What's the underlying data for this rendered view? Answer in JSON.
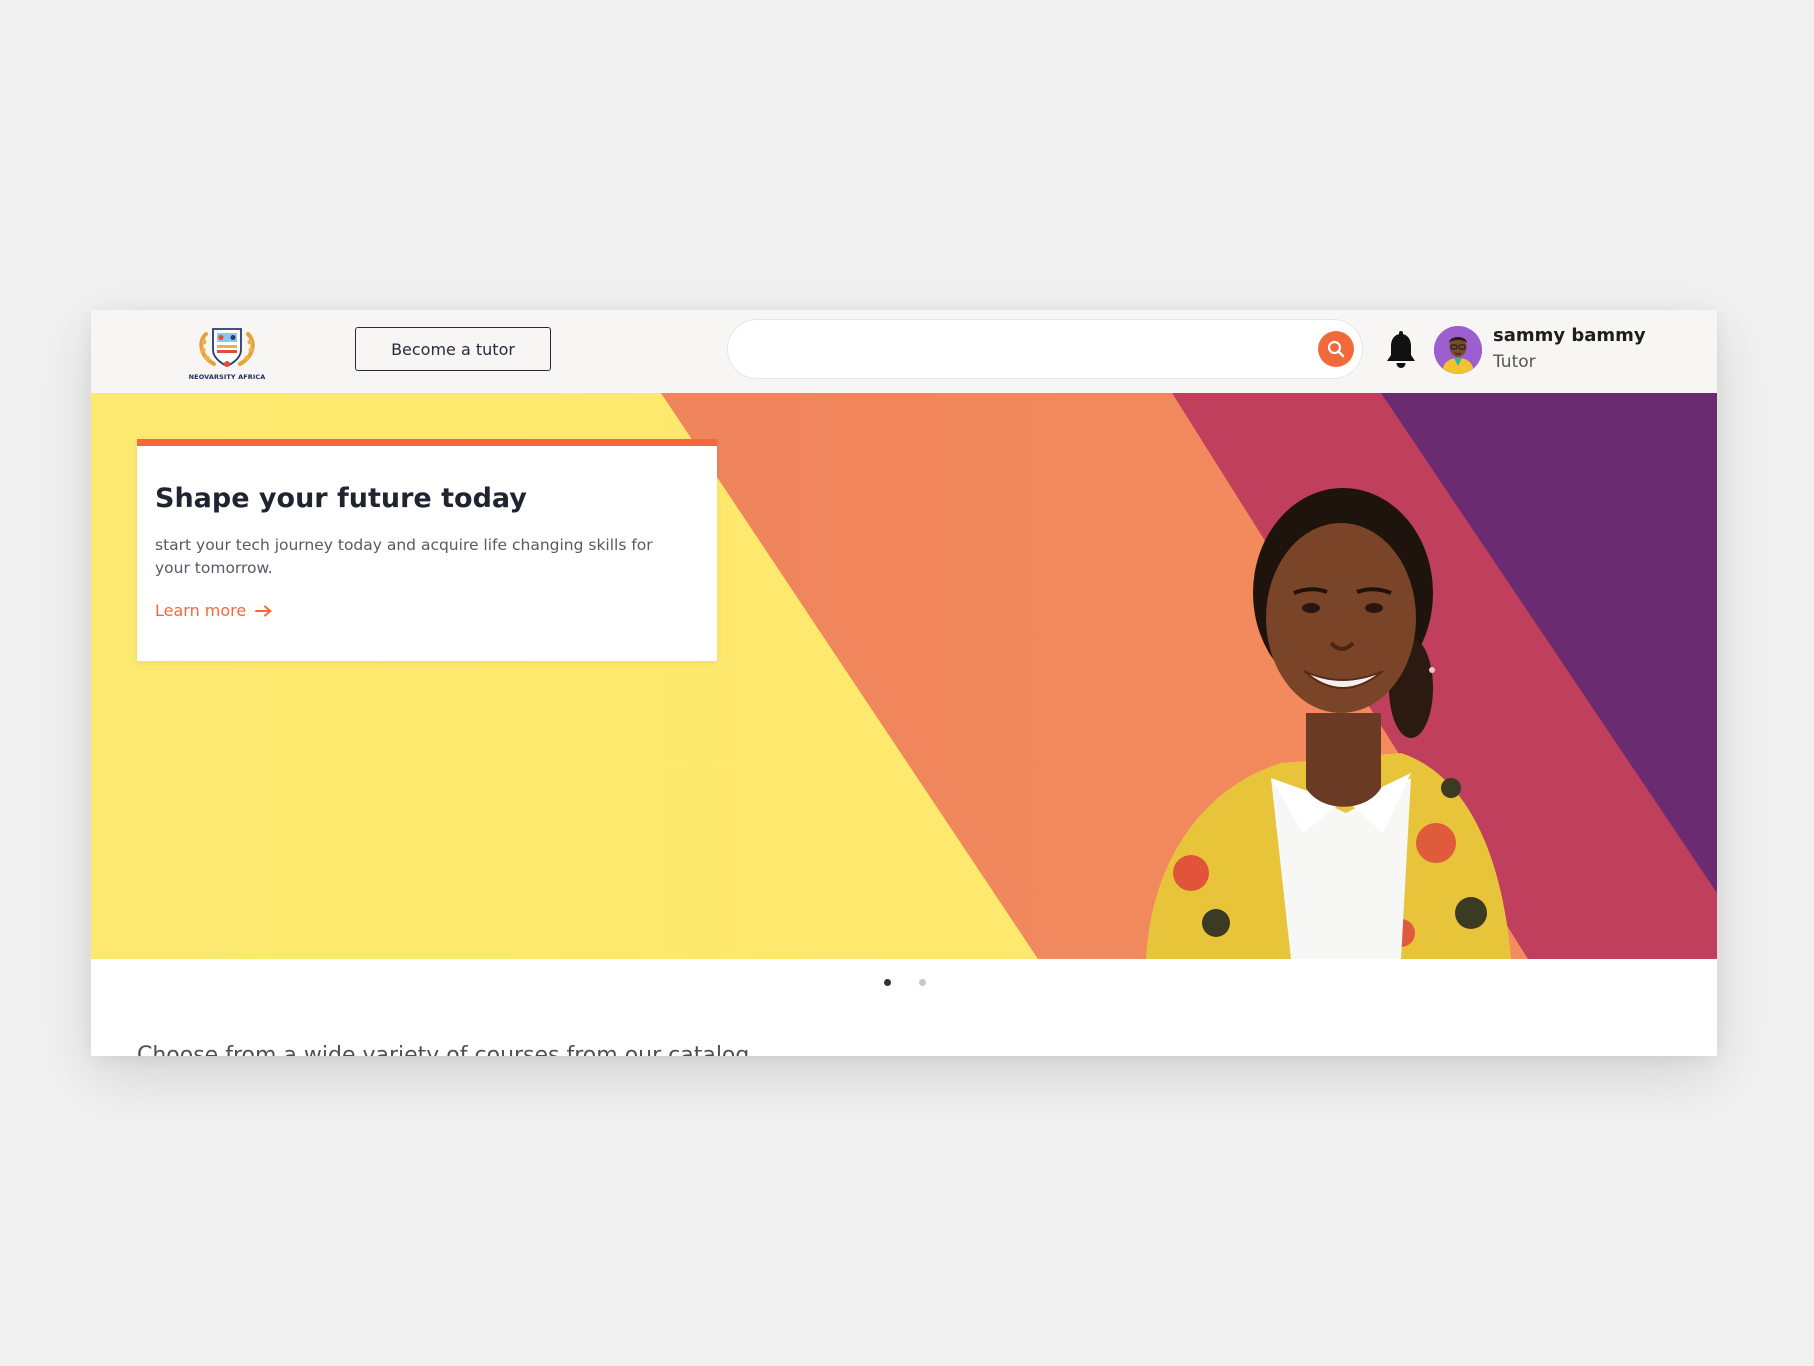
{
  "header": {
    "logo_text": "NEOVARSITY AFRICA",
    "become_tutor_label": "Become a tutor",
    "search": {
      "placeholder": "",
      "icon": "search-icon",
      "accent_color": "#f26a3b"
    },
    "notification_icon": "bell-icon",
    "user": {
      "name": "sammy bammy",
      "role": "Tutor",
      "avatar": "avatar"
    }
  },
  "hero": {
    "title": "Shape your future today",
    "description": "start your tech journey today and acquire life changing skills for your tomorrow.",
    "learn_more_label": "Learn more",
    "learn_more_icon": "arrow-right-icon",
    "colors": {
      "yellow": "#fee86c",
      "orange": "#f48c5e",
      "magenta": "#c0405c",
      "purple": "#6b2c71",
      "accent": "#f26a3b"
    }
  },
  "carousel": {
    "slides": 2,
    "active": 1
  },
  "catalog": {
    "heading": "Choose from a wide variety of courses from our catalog"
  }
}
